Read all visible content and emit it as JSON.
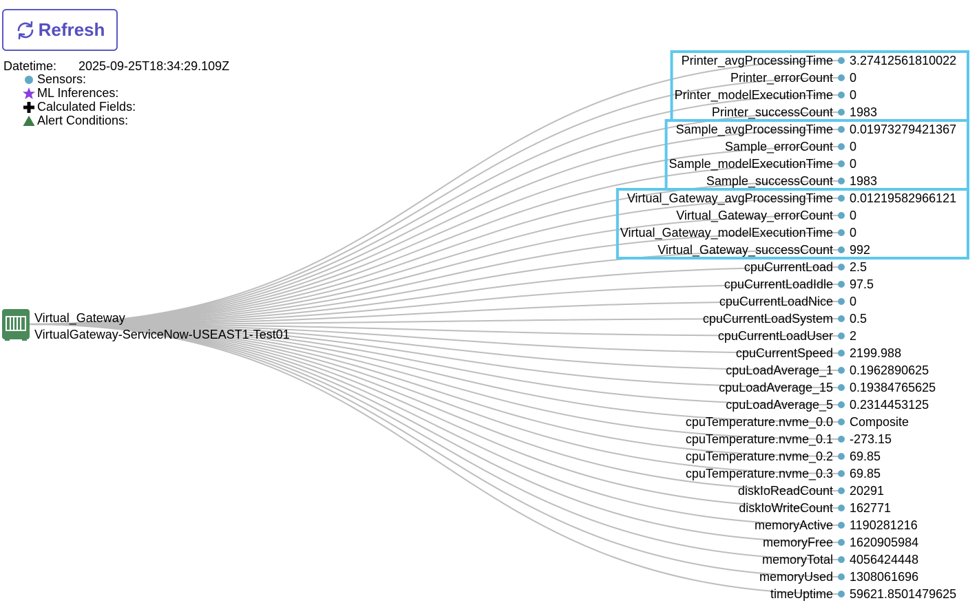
{
  "toolbar": {
    "refresh_label": "Refresh"
  },
  "info": {
    "datetime_label": "Datetime:",
    "datetime_value": "2025-09-25T18:34:29.109Z"
  },
  "legend": [
    {
      "label": "Sensors:",
      "icon": "circle-icon",
      "color": "#62a8c4"
    },
    {
      "label": "ML Inferences:",
      "icon": "star-icon",
      "color": "#8a3ce0"
    },
    {
      "label": "Calculated Fields:",
      "icon": "plus-icon",
      "color": "#000000"
    },
    {
      "label": "Alert Conditions:",
      "icon": "triangle-icon",
      "color": "#3e7d4a"
    }
  ],
  "root": {
    "name": "Virtual_Gateway",
    "subtitle": "VirtualGateway-ServiceNow-USEAST1-Test01",
    "icon": "gateway-icon",
    "icon_color": "#4a8a5a"
  },
  "colors": {
    "link": "#bdbdbd",
    "node": "#62a8c4",
    "highlight": "#5ec8ec"
  },
  "sensors": [
    {
      "name": "Printer_avgProcessingTime",
      "value": "3.27412561810022"
    },
    {
      "name": "Printer_errorCount",
      "value": "0"
    },
    {
      "name": "Printer_modelExecutionTime",
      "value": "0"
    },
    {
      "name": "Printer_successCount",
      "value": "1983"
    },
    {
      "name": "Sample_avgProcessingTime",
      "value": "0.01973279421367"
    },
    {
      "name": "Sample_errorCount",
      "value": "0"
    },
    {
      "name": "Sample_modelExecutionTime",
      "value": "0"
    },
    {
      "name": "Sample_successCount",
      "value": "1983"
    },
    {
      "name": "Virtual_Gateway_avgProcessingTime",
      "value": "0.01219582966121"
    },
    {
      "name": "Virtual_Gateway_errorCount",
      "value": "0"
    },
    {
      "name": "Virtual_Gateway_modelExecutionTime",
      "value": "0"
    },
    {
      "name": "Virtual_Gateway_successCount",
      "value": "992"
    },
    {
      "name": "cpuCurrentLoad",
      "value": "2.5"
    },
    {
      "name": "cpuCurrentLoadIdle",
      "value": "97.5"
    },
    {
      "name": "cpuCurrentLoadNice",
      "value": "0"
    },
    {
      "name": "cpuCurrentLoadSystem",
      "value": "0.5"
    },
    {
      "name": "cpuCurrentLoadUser",
      "value": "2"
    },
    {
      "name": "cpuCurrentSpeed",
      "value": "2199.988"
    },
    {
      "name": "cpuLoadAverage_1",
      "value": "0.1962890625"
    },
    {
      "name": "cpuLoadAverage_15",
      "value": "0.19384765625"
    },
    {
      "name": "cpuLoadAverage_5",
      "value": "0.2314453125"
    },
    {
      "name": "cpuTemperature.nvme_0.0",
      "value": "Composite"
    },
    {
      "name": "cpuTemperature.nvme_0.1",
      "value": "-273.15"
    },
    {
      "name": "cpuTemperature.nvme_0.2",
      "value": "69.85"
    },
    {
      "name": "cpuTemperature.nvme_0.3",
      "value": "69.85"
    },
    {
      "name": "diskIoReadCount",
      "value": "20291"
    },
    {
      "name": "diskIoWriteCount",
      "value": "162771"
    },
    {
      "name": "memoryActive",
      "value": "1190281216"
    },
    {
      "name": "memoryFree",
      "value": "1620905984"
    },
    {
      "name": "memoryTotal",
      "value": "4056424448"
    },
    {
      "name": "memoryUsed",
      "value": "1308061696"
    },
    {
      "name": "timeUptime",
      "value": "59621.8501479625"
    }
  ],
  "groups": [
    {
      "name": "Printer",
      "start": 0,
      "end": 3
    },
    {
      "name": "Sample",
      "start": 4,
      "end": 7
    },
    {
      "name": "Virtual_Gateway",
      "start": 8,
      "end": 11
    }
  ]
}
